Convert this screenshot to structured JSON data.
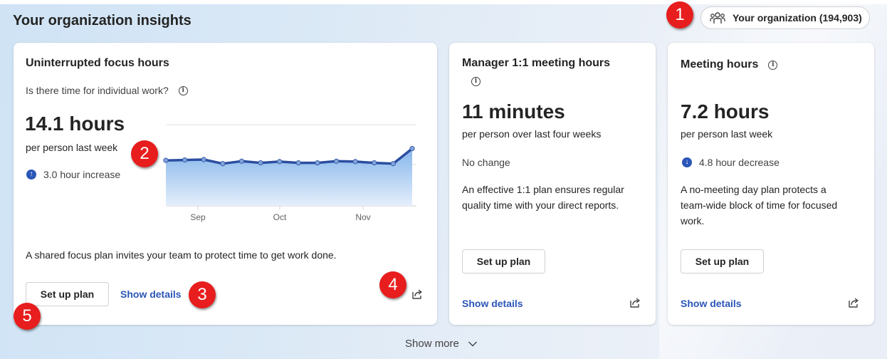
{
  "header": {
    "title": "Your organization insights",
    "org_selector": {
      "icon": "people-group-icon",
      "label": "Your organization (194,903)"
    }
  },
  "cards": [
    {
      "title": "Uninterrupted focus hours",
      "question": "Is there time for individual work?",
      "value": "14.1 hours",
      "subtitle": "per person last week",
      "trend": {
        "direction": "up",
        "text": "3.0 hour increase"
      },
      "description": "A shared focus plan invites your team to protect time to get work done.",
      "button": "Set up plan",
      "link": "Show details"
    },
    {
      "title": "Manager 1:1 meeting hours",
      "value": "11 minutes",
      "subtitle": "per person over last four weeks",
      "trend": {
        "direction": "none",
        "text": "No change"
      },
      "description_lines": [
        "An effective 1:1 plan ensures regular",
        "quality time with your direct reports."
      ],
      "button": "Set up plan",
      "link": "Show details"
    },
    {
      "title": "Meeting hours",
      "value": "7.2 hours",
      "subtitle": "per person last week",
      "trend": {
        "direction": "down",
        "text": "4.8 hour decrease"
      },
      "description_lines": [
        "A no-meeting day plan protects a",
        "team-wide block of time for focused",
        "work."
      ],
      "button": "Set up plan",
      "link": "Show details"
    }
  ],
  "chart_data": {
    "type": "area",
    "x_tick_labels": [
      "Sep",
      "Oct",
      "Nov"
    ],
    "values": [
      11.2,
      11.3,
      11.4,
      10.4,
      11.0,
      10.6,
      10.9,
      10.6,
      10.6,
      11.0,
      10.9,
      10.6,
      10.4,
      14.1
    ],
    "ylim": [
      0,
      20
    ],
    "grid": true,
    "colors": {
      "line": "#2b4ea0",
      "fill_top": "#7fb2ea",
      "fill_bottom": "#e3eefb"
    }
  },
  "footer": {
    "show_more": "Show more"
  },
  "annotations": [
    "1",
    "2",
    "3",
    "4",
    "5"
  ],
  "colors": {
    "accent": "#2b56b8",
    "badge": "#e81d1d"
  }
}
